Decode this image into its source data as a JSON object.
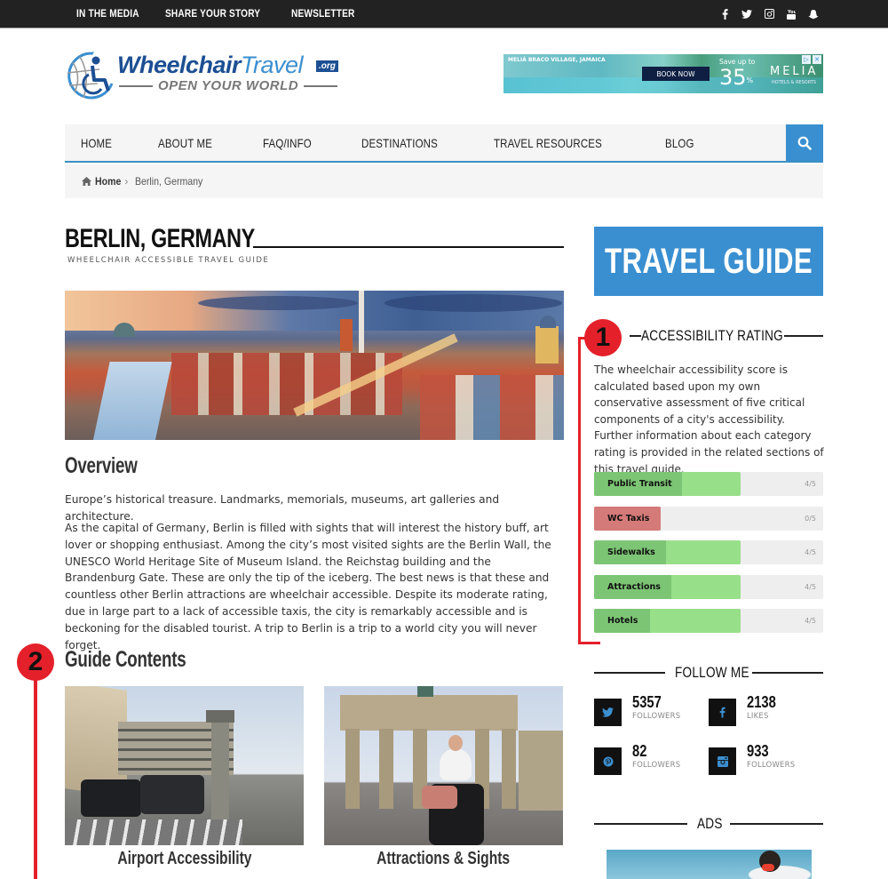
{
  "topbar": {
    "links": [
      "IN THE MEDIA",
      "SHARE YOUR STORY",
      "NEWSLETTER"
    ],
    "social_icons": [
      {
        "name": "facebook-icon",
        "glyph": "f"
      },
      {
        "name": "twitter-icon",
        "glyph": "🐦"
      },
      {
        "name": "instagram-icon",
        "glyph": "◙"
      },
      {
        "name": "youtube-icon",
        "glyph": "▶"
      },
      {
        "name": "snapchat-icon",
        "glyph": "👻"
      }
    ]
  },
  "logo": {
    "brand_part1": "Wheelchair",
    "brand_part2": "Travel",
    "tld": ".org",
    "tagline": "OPEN YOUR WORLD"
  },
  "ad_banner": {
    "location": "MELIÁ BRACO VILLAGE, JAMAICA",
    "cta": "BOOK NOW",
    "save_text": "Save up to",
    "discount": "35",
    "discount_unit": "%",
    "brand": "MELIA",
    "brand_sub": "HOTELS & RESORTS"
  },
  "nav": {
    "items": [
      "HOME",
      "ABOUT ME",
      "FAQ/INFO",
      "DESTINATIONS",
      "TRAVEL RESOURCES",
      "BLOG"
    ],
    "search_icon": "search-icon"
  },
  "breadcrumb": {
    "home": "Home",
    "separator": "›",
    "current": "Berlin, Germany"
  },
  "page": {
    "title": "BERLIN, GERMANY",
    "subtitle": "WHEELCHAIR ACCESSIBLE TRAVEL GUIDE",
    "overview_heading": "Overview",
    "intro": "Europe’s historical treasure. Landmarks, memorials, museums, art galleries and architecture.",
    "paragraph": "As the capital of Germany, Berlin is filled with sights that will interest the history buff, art lover or shopping enthusiast. Among the city’s most visited sights are the Berlin Wall, the UNESCO World Heritage Site of Museum Island. the Reichstag building and the Brandenburg Gate. These are only the tip of the iceberg. The best news is that these and countless other Berlin attractions are wheelchair accessible. Despite its moderate rating, due in large part to a lack of accessible taxis, the city is remarkably accessible and is beckoning for the disabled tourist. A trip to Berlin is a trip to a world city you will never forget.",
    "guide_heading": "Guide Contents",
    "guide_cards": [
      {
        "caption": "Airport Accessibility"
      },
      {
        "caption": "Attractions & Sights"
      }
    ]
  },
  "annotations": {
    "marker1": "1",
    "marker2": "2",
    "color": "#e4202a"
  },
  "sidebar": {
    "travel_guide_label": "TRAVEL GUIDE",
    "accessibility": {
      "title": "ACCESSIBILITY RATING",
      "description": "The wheelchair accessibility score is calculated based upon my own conservative assessment of five critical components of a city's accessibility. Further information about each category rating is provided in the related sections of this travel guide.",
      "ratings": [
        {
          "label": "Public Transit",
          "score": 4,
          "max": 5,
          "display": "4/5",
          "status": "good"
        },
        {
          "label": "WC Taxis",
          "score": 0,
          "max": 5,
          "display": "0/5",
          "status": "bad"
        },
        {
          "label": "Sidewalks",
          "score": 4,
          "max": 5,
          "display": "4/5",
          "status": "good"
        },
        {
          "label": "Attractions",
          "score": 4,
          "max": 5,
          "display": "4/5",
          "status": "good"
        },
        {
          "label": "Hotels",
          "score": 4,
          "max": 5,
          "display": "4/5",
          "status": "good"
        }
      ],
      "colors": {
        "good_fill": "#98df8a",
        "good_label": "#7cc574",
        "bad_label": "#d47a78",
        "track": "#eeeeee"
      }
    },
    "follow": {
      "title": "FOLLOW ME",
      "stats": [
        {
          "network": "twitter",
          "count": "5357",
          "label": "FOLLOWERS"
        },
        {
          "network": "facebook",
          "count": "2138",
          "label": "LIKES"
        },
        {
          "network": "pinterest",
          "count": "82",
          "label": "FOLLOWERS"
        },
        {
          "network": "instagram",
          "count": "933",
          "label": "FOLLOWERS"
        }
      ]
    },
    "ads_title": "ADS"
  },
  "colors": {
    "accent_blue": "#3a8fd0",
    "topbar_bg": "#222222",
    "nav_bg": "#f5f5f5"
  }
}
